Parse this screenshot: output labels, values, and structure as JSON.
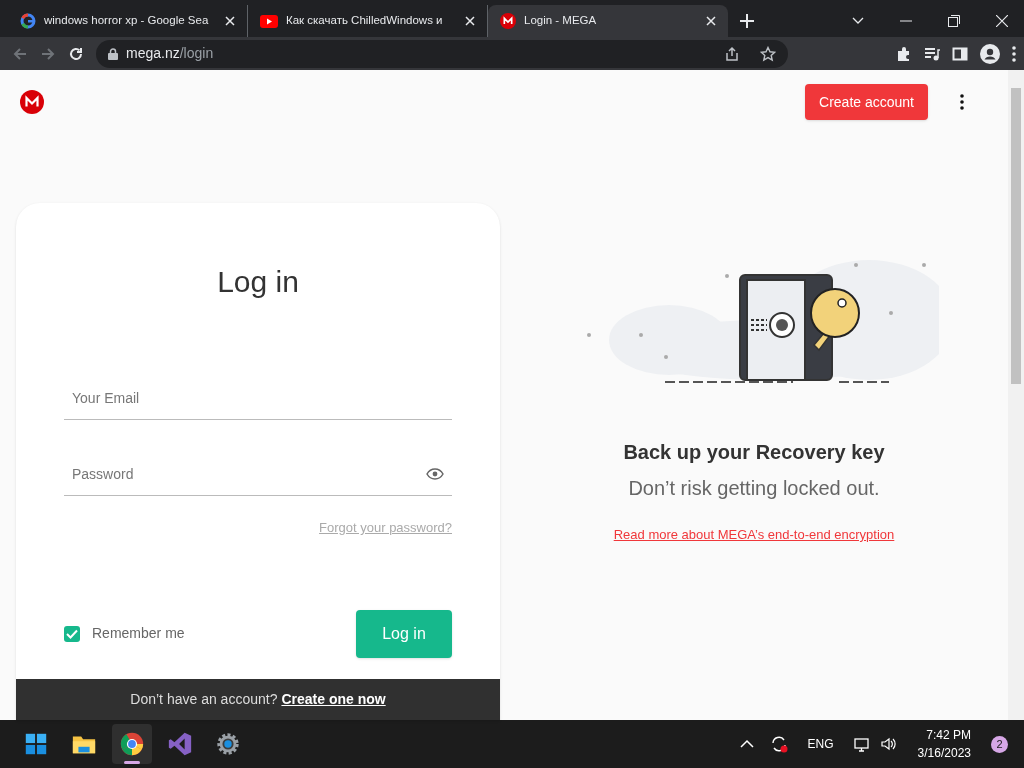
{
  "browser": {
    "tabs": [
      {
        "title": "windows horror xp - Google Sea",
        "kind": "google",
        "selected": false
      },
      {
        "title": "Как скачать ChilledWindows и",
        "kind": "youtube",
        "selected": false
      },
      {
        "title": "Login - MEGA",
        "kind": "mega",
        "selected": true
      }
    ],
    "url": {
      "host": "mega.nz",
      "path": "/login"
    }
  },
  "header": {
    "create_account": "Create account"
  },
  "login": {
    "title": "Log in",
    "email": {
      "placeholder": "Your Email"
    },
    "password": {
      "placeholder": "Password"
    },
    "forgot": "Forgot your password?",
    "remember": {
      "label": "Remember me",
      "checked": true
    },
    "submit": "Log in",
    "footer": {
      "text": "Don’t have an account?",
      "link": "Create one now"
    }
  },
  "promo": {
    "heading": "Back up your Recovery key",
    "subheading": "Don’t risk getting locked out.",
    "link": "Read more about MEGA’s end-to-end encryption"
  },
  "taskbar": {
    "apps": [
      {
        "kind": "start",
        "selected": false
      },
      {
        "kind": "folder",
        "selected": false
      },
      {
        "kind": "chrome",
        "selected": true
      },
      {
        "kind": "studio",
        "selected": false
      },
      {
        "kind": "settings",
        "selected": false
      }
    ],
    "language": "ENG",
    "time": "7:42 PM",
    "date": "3/16/2023",
    "notifications": "2"
  }
}
